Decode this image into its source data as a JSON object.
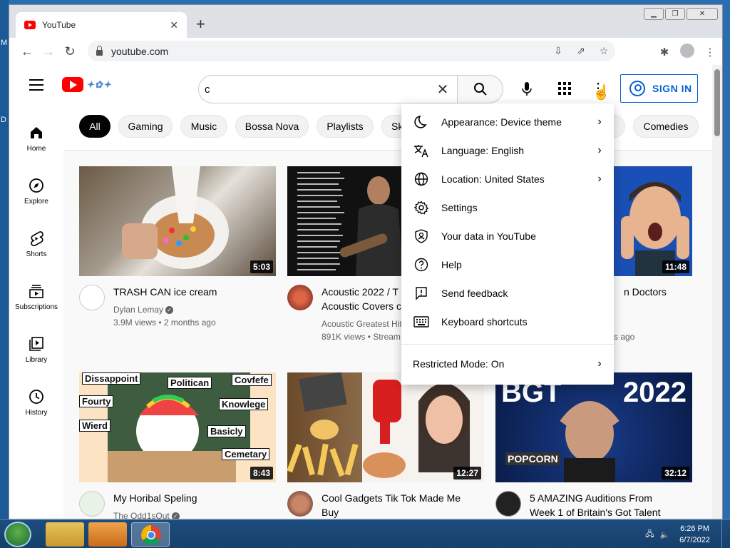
{
  "browser": {
    "tab_title": "YouTube",
    "url": "youtube.com"
  },
  "youtube": {
    "search_value": "c",
    "sign_in": "SIGN IN",
    "guide": [
      "Home",
      "Explore",
      "Shorts",
      "Subscriptions",
      "Library",
      "History"
    ],
    "chips": [
      "All",
      "Gaming",
      "Music",
      "Bossa Nova",
      "Playlists",
      "Sk",
      "Comedies"
    ],
    "videos": [
      {
        "title": "TRASH CAN ice cream",
        "channel": "Dylan Lemay",
        "views": "3.9M views",
        "age": "2 months ago",
        "duration": "5:03",
        "verified": true
      },
      {
        "title": "Acoustic 2022 / T",
        "title_line2": "Acoustic Covers c",
        "channel": "Acoustic Greatest Hit",
        "views": "891K views",
        "age": "Stream",
        "duration": ""
      },
      {
        "title": "n Doctors",
        "age_fragment": "s ago",
        "duration": "11:48"
      },
      {
        "title": "My Horibal Speling",
        "channel": "The Odd1sOut",
        "duration": "8:43"
      },
      {
        "title": "Cool Gadgets Tik Tok Made Me",
        "title_line2": "Buy",
        "duration": "12:27"
      },
      {
        "title": "5 AMAZING Auditions From",
        "title_line2": "Week 1 of Britain's Got Talent",
        "duration": "32:12"
      }
    ],
    "thumb_text": {
      "bgt": "BGT",
      "year": "2022",
      "popcorn": "POPCORN",
      "comic": [
        "Dissappoint",
        "Politican",
        "Covfefe",
        "Fourty",
        "Knowlege",
        "Wierd",
        "Basicly",
        "Cemetary"
      ]
    },
    "menu": {
      "items": [
        {
          "label": "Appearance: Device theme",
          "icon": "moon-icon",
          "chevron": true
        },
        {
          "label": "Language: English",
          "icon": "translate-icon",
          "chevron": true
        },
        {
          "label": "Location: United States",
          "icon": "globe-icon",
          "chevron": true
        },
        {
          "label": "Settings",
          "icon": "gear-icon",
          "chevron": false
        },
        {
          "label": "Your data in YouTube",
          "icon": "shield-person-icon",
          "chevron": false
        },
        {
          "label": "Help",
          "icon": "help-icon",
          "chevron": false
        },
        {
          "label": "Send feedback",
          "icon": "feedback-icon",
          "chevron": false
        },
        {
          "label": "Keyboard shortcuts",
          "icon": "keyboard-icon",
          "chevron": false
        }
      ],
      "restricted": "Restricted Mode: On"
    }
  },
  "taskbar": {
    "time": "6:26 PM",
    "date": "6/7/2022"
  },
  "desktop": {
    "letters": [
      "M",
      "D"
    ]
  },
  "colors": {
    "brand": "#ff0000",
    "link": "#065fd4",
    "taskbar": "#1c4c7e"
  }
}
